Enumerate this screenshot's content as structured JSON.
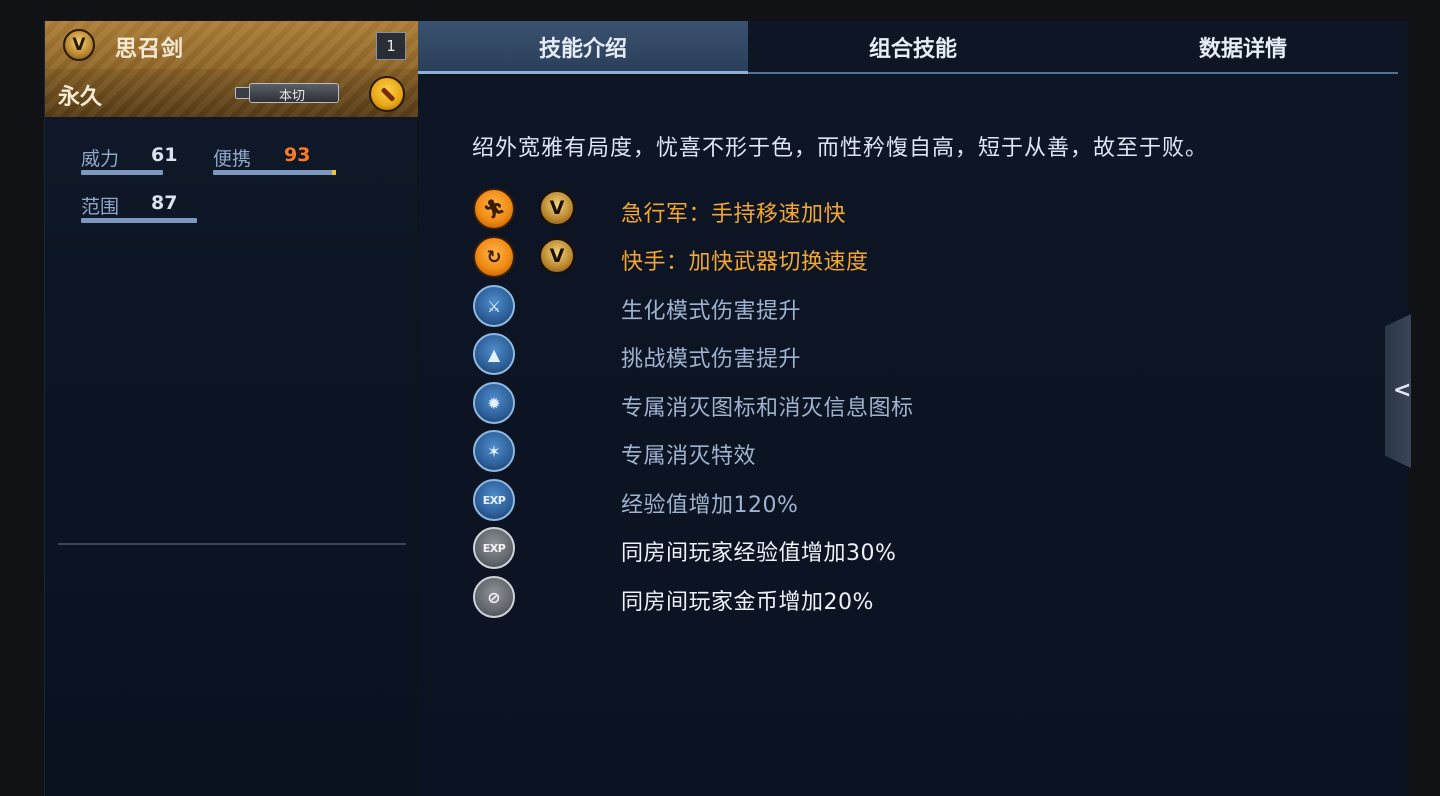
{
  "weapon": {
    "badge": "V",
    "name": "思召剑",
    "count": "1",
    "duration": "永久",
    "tag_label": "本切"
  },
  "stats": [
    {
      "label": "威力",
      "value": "61",
      "bar": 0.61
    },
    {
      "label": "便携",
      "value": "93",
      "bar": 0.93,
      "highlight": "orange"
    },
    {
      "label": "范围",
      "value": "87",
      "bar": 0.87
    }
  ],
  "tabs": [
    {
      "label": "技能介绍",
      "active": true
    },
    {
      "label": "组合技能",
      "active": false
    },
    {
      "label": "数据详情",
      "active": false
    }
  ],
  "description": "绍外宽雅有局度，忧喜不形于色，而性矜愎自高，短于从善，故至于败。",
  "skills": [
    {
      "icon": "running-icon",
      "style": "gold",
      "v": "V",
      "text": "急行军：手持移速加快"
    },
    {
      "icon": "weapon-swap-icon",
      "style": "gold",
      "v": "V",
      "text": "快手：加快武器切换速度"
    },
    {
      "icon": "zombie-mode-icon",
      "style": "blue",
      "text": "生化模式伤害提升"
    },
    {
      "icon": "challenge-mode-icon",
      "style": "blue",
      "text": "挑战模式伤害提升"
    },
    {
      "icon": "kill-icon-badge",
      "style": "blue",
      "text": "专属消灭图标和消灭信息图标"
    },
    {
      "icon": "kill-effect-icon",
      "style": "blue",
      "text": "专属消灭特效"
    },
    {
      "icon": "exp-icon",
      "style": "blue",
      "glyph": "EXP",
      "text": "经验值增加120%"
    },
    {
      "icon": "room-exp-icon",
      "style": "gray",
      "glyph": "EXP",
      "text": "同房间玩家经验值增加30%"
    },
    {
      "icon": "room-coin-icon",
      "style": "gray",
      "text": "同房间玩家金币增加20%"
    }
  ],
  "colors": {
    "gold_text": "#f2a733",
    "orange_value": "#ff7a22",
    "active_tab": "#3a5270"
  }
}
